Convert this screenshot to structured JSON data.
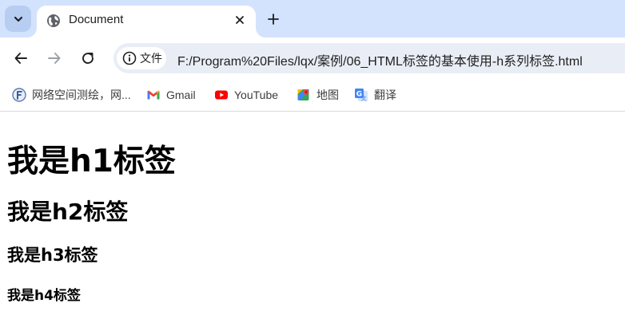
{
  "tab_strip": {
    "active_tab": {
      "title": "Document",
      "favicon": "globe-icon"
    },
    "new_tab_icon": "plus-icon",
    "search_tabs_icon": "chevron-down-icon"
  },
  "toolbar": {
    "back_icon": "arrow-left-icon",
    "forward_icon": "arrow-right-icon",
    "reload_icon": "reload-icon",
    "site_chip_label": "文件",
    "url": "F:/Program%20Files/lqx/案例/06_HTML标签的基本使用-h系列标签.html"
  },
  "bookmarks": [
    {
      "label": "网络空间测绘，网...",
      "icon": "fofa-icon"
    },
    {
      "label": "Gmail",
      "icon": "gmail-icon"
    },
    {
      "label": "YouTube",
      "icon": "youtube-icon"
    },
    {
      "label": "地图",
      "icon": "maps-icon"
    },
    {
      "label": "翻译",
      "icon": "translate-icon"
    }
  ],
  "page": {
    "h1": "我是h1标签",
    "h2": "我是h2标签",
    "h3": "我是h3标签",
    "h4": "我是h4标签"
  },
  "colors": {
    "tab_strip_bg": "#d3e3fd",
    "omnibox_bg": "#e9eef6",
    "page_bg": "#ffffff"
  }
}
